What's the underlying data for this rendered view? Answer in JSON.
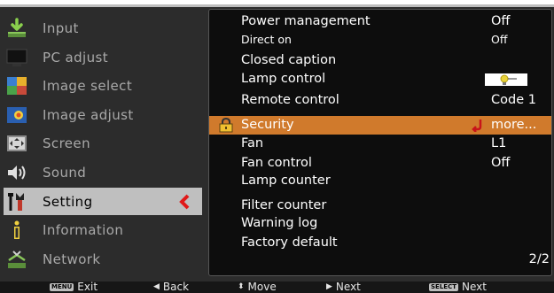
{
  "menu": {
    "items": [
      {
        "label": "Input",
        "icon": "input-arrow-icon",
        "active": false
      },
      {
        "label": "PC adjust",
        "icon": "pc-adjust-icon",
        "active": false
      },
      {
        "label": "Image select",
        "icon": "image-select-icon",
        "active": false
      },
      {
        "label": "Image adjust",
        "icon": "image-adjust-icon",
        "active": false
      },
      {
        "label": "Screen",
        "icon": "screen-icon",
        "active": false
      },
      {
        "label": "Sound",
        "icon": "sound-icon",
        "active": false
      },
      {
        "label": "Setting",
        "icon": "setting-tools-icon",
        "active": true
      },
      {
        "label": "Information",
        "icon": "information-icon",
        "active": false
      },
      {
        "label": "Network",
        "icon": "network-icon",
        "active": false
      }
    ]
  },
  "settings": {
    "rows": [
      {
        "label": "Power management",
        "value": "Off"
      },
      {
        "label": "Direct on",
        "value": "Off"
      },
      {
        "label": "Closed caption",
        "value": ""
      },
      {
        "label": "Lamp control",
        "value": ""
      },
      {
        "label": "Remote control",
        "value": "Code 1"
      },
      {
        "label": "Security",
        "value": "more..."
      },
      {
        "label": "Fan",
        "value": "L1"
      },
      {
        "label": "Fan control",
        "value": "Off"
      },
      {
        "label": "Lamp counter",
        "value": ""
      },
      {
        "label": "Filter counter",
        "value": ""
      },
      {
        "label": "Warning log",
        "value": ""
      },
      {
        "label": "Factory default",
        "value": ""
      }
    ],
    "page": "2/2"
  },
  "footer": {
    "exit_key": "MENU",
    "exit_label": "Exit",
    "back_label": "Back",
    "move_label": "Move",
    "next_label": "Next",
    "select_key": "SELECT",
    "select_label": "Next"
  },
  "colors": {
    "highlight": "#d07a2c",
    "active_menu_bg": "#bfbfbf",
    "panel_bg": "#0d0d0d",
    "frame_bg": "#2c2c2c"
  }
}
